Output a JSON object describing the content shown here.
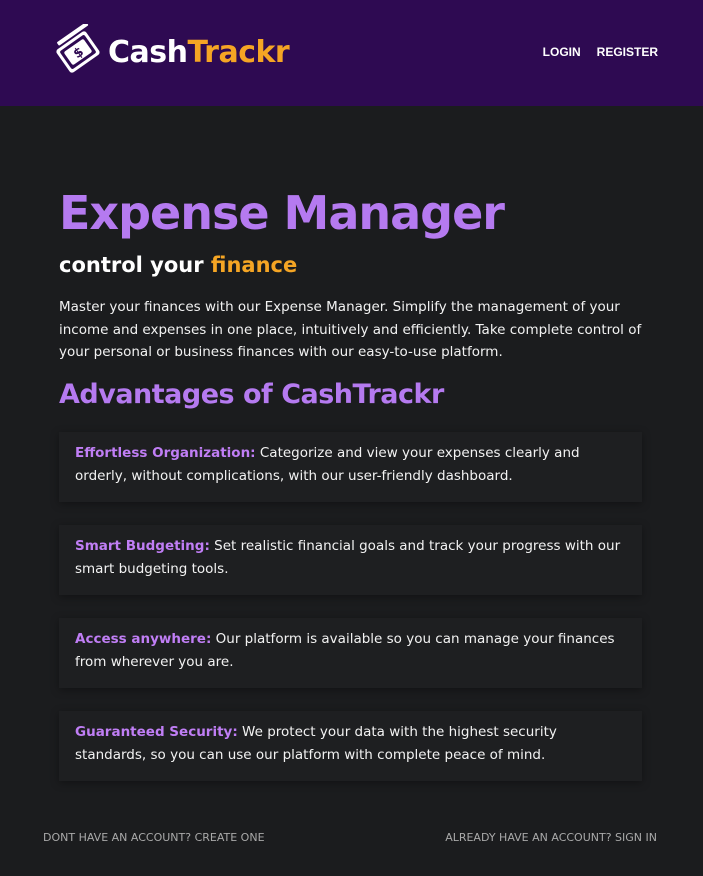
{
  "header": {
    "logo": {
      "cash": "Cash",
      "trackr": "Trackr"
    },
    "nav": {
      "login": "LOGIN",
      "register": "REGISTER"
    }
  },
  "hero": {
    "title": "Expense Manager",
    "subtitle_prefix": "control your ",
    "subtitle_accent": "finance",
    "intro": "Master your finances with our Expense Manager. Simplify the management of your income and expenses in one place, intuitively and efficiently. Take complete control of your personal or business finances with our easy-to-use platform."
  },
  "advantages": {
    "title": "Advantages of CashTrackr",
    "items": [
      {
        "label": "Effortless Organization:",
        "text": " Categorize and view your expenses clearly and orderly, without complications, with our user-friendly dashboard."
      },
      {
        "label": "Smart Budgeting:",
        "text": " Set realistic financial goals and track your progress with our smart budgeting tools."
      },
      {
        "label": "Access anywhere:",
        "text": " Our platform is available so you can manage your finances from wherever you are."
      },
      {
        "label": "Guaranteed Security:",
        "text": " We protect your data with the highest security standards, so you can use our platform with complete peace of mind."
      }
    ]
  },
  "footer": {
    "create_account": "DONT HAVE AN ACCOUNT? CREATE ONE",
    "sign_in": "ALREADY HAVE AN ACCOUNT? SIGN IN"
  },
  "colors": {
    "header_bg": "#2e0a52",
    "page_bg": "#1b1c1e",
    "purple": "#b57af0",
    "orange": "#f5a524"
  }
}
